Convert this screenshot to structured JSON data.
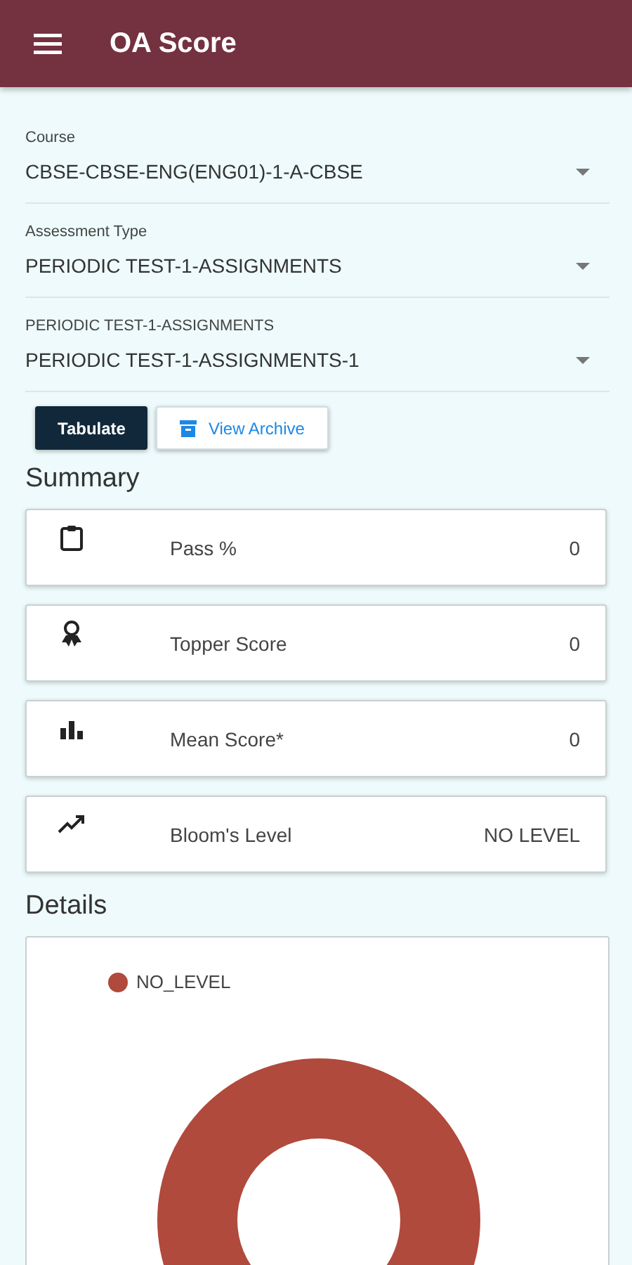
{
  "app_bar": {
    "title": "OA Score"
  },
  "fields": [
    {
      "label": "Course",
      "value": "CBSE-CBSE-ENG(ENG01)-1-A-CBSE"
    },
    {
      "label": "Assessment Type",
      "value": "PERIODIC TEST-1-ASSIGNMENTS"
    },
    {
      "label": "PERIODIC TEST-1-ASSIGNMENTS",
      "value": "PERIODIC TEST-1-ASSIGNMENTS-1"
    }
  ],
  "buttons": [
    {
      "kind": "primary",
      "label": "Tabulate"
    },
    {
      "kind": "outline",
      "label": "View Archive"
    }
  ],
  "summary": {
    "title": "Summary",
    "items": [
      {
        "kind": "clipboard",
        "label": "Pass %",
        "value": "0"
      },
      {
        "kind": "award",
        "label": "Topper Score",
        "value": "0"
      },
      {
        "kind": "bars",
        "label": "Mean Score*",
        "value": "0"
      },
      {
        "kind": "trend",
        "label": "Bloom's Level",
        "value": "NO LEVEL"
      }
    ]
  },
  "details": {
    "title": "Details",
    "legend": [
      {
        "label": "NO_LEVEL",
        "color": "#b04a3c"
      }
    ]
  }
}
